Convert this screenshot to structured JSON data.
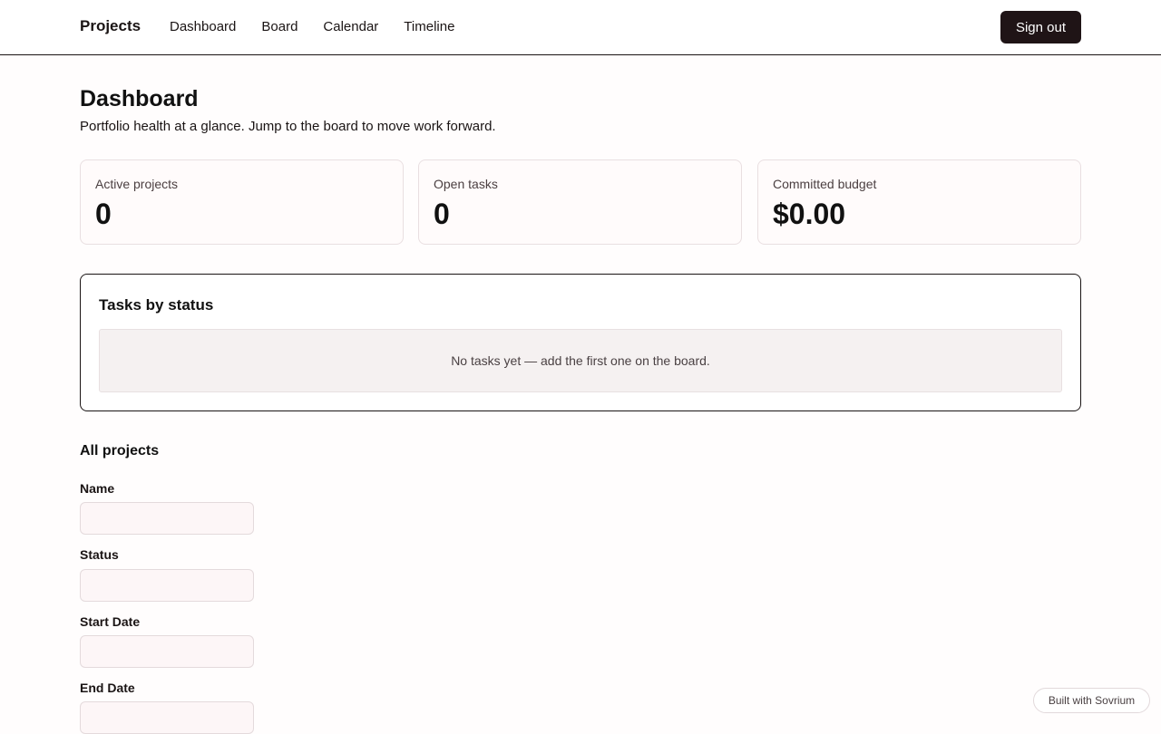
{
  "header": {
    "brand": "Projects",
    "nav": [
      "Dashboard",
      "Board",
      "Calendar",
      "Timeline"
    ],
    "sign_out_label": "Sign out"
  },
  "page": {
    "title": "Dashboard",
    "subtitle": "Portfolio health at a glance. Jump to the board to move work forward."
  },
  "stats": [
    {
      "label": "Active projects",
      "value": "0"
    },
    {
      "label": "Open tasks",
      "value": "0"
    },
    {
      "label": "Committed budget",
      "value": "$0.00"
    }
  ],
  "tasks_panel": {
    "title": "Tasks by status",
    "empty_message": "No tasks yet — add the first one on the board."
  },
  "projects": {
    "title": "All projects",
    "fields": [
      {
        "label": "Name",
        "value": ""
      },
      {
        "label": "Status",
        "value": ""
      },
      {
        "label": "Start Date",
        "value": ""
      },
      {
        "label": "End Date",
        "value": ""
      }
    ]
  },
  "footer": {
    "built_with": "Built with Sovrium"
  },
  "colors": {
    "primary_button": "#1f1416",
    "card_border": "#e9dfe1",
    "empty_bg": "#f5f1f1",
    "input_bg": "#fdf6f7"
  }
}
